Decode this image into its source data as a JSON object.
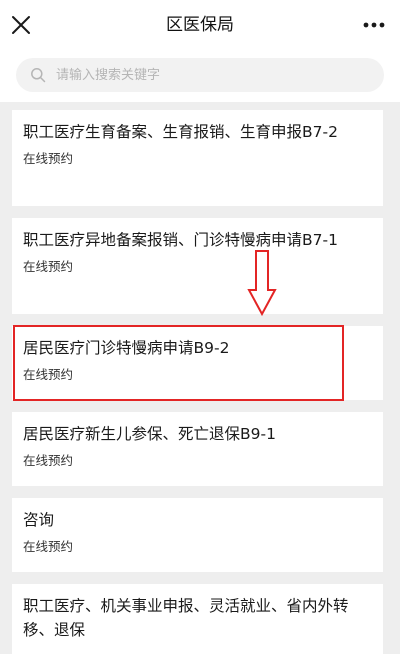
{
  "header": {
    "title": "区医保局"
  },
  "search": {
    "placeholder": "请输入搜索关键字"
  },
  "services": [
    {
      "title": "职工医疗生育备案、生育报销、生育申报B7-2",
      "subtitle": "在线预约"
    },
    {
      "title": "职工医疗异地备案报销、门诊特慢病申请B7-1",
      "subtitle": "在线预约"
    },
    {
      "title": "居民医疗门诊特慢病申请B9-2",
      "subtitle": "在线预约"
    },
    {
      "title": "居民医疗新生儿参保、死亡退保B9-1",
      "subtitle": "在线预约"
    },
    {
      "title": "咨询",
      "subtitle": "在线预约"
    },
    {
      "title": "职工医疗、机关事业申报、灵活就业、省内外转移、退保",
      "subtitle": ""
    }
  ],
  "colors": {
    "annotation": "#e32525",
    "background": "#eeeeee",
    "card": "#ffffff"
  }
}
